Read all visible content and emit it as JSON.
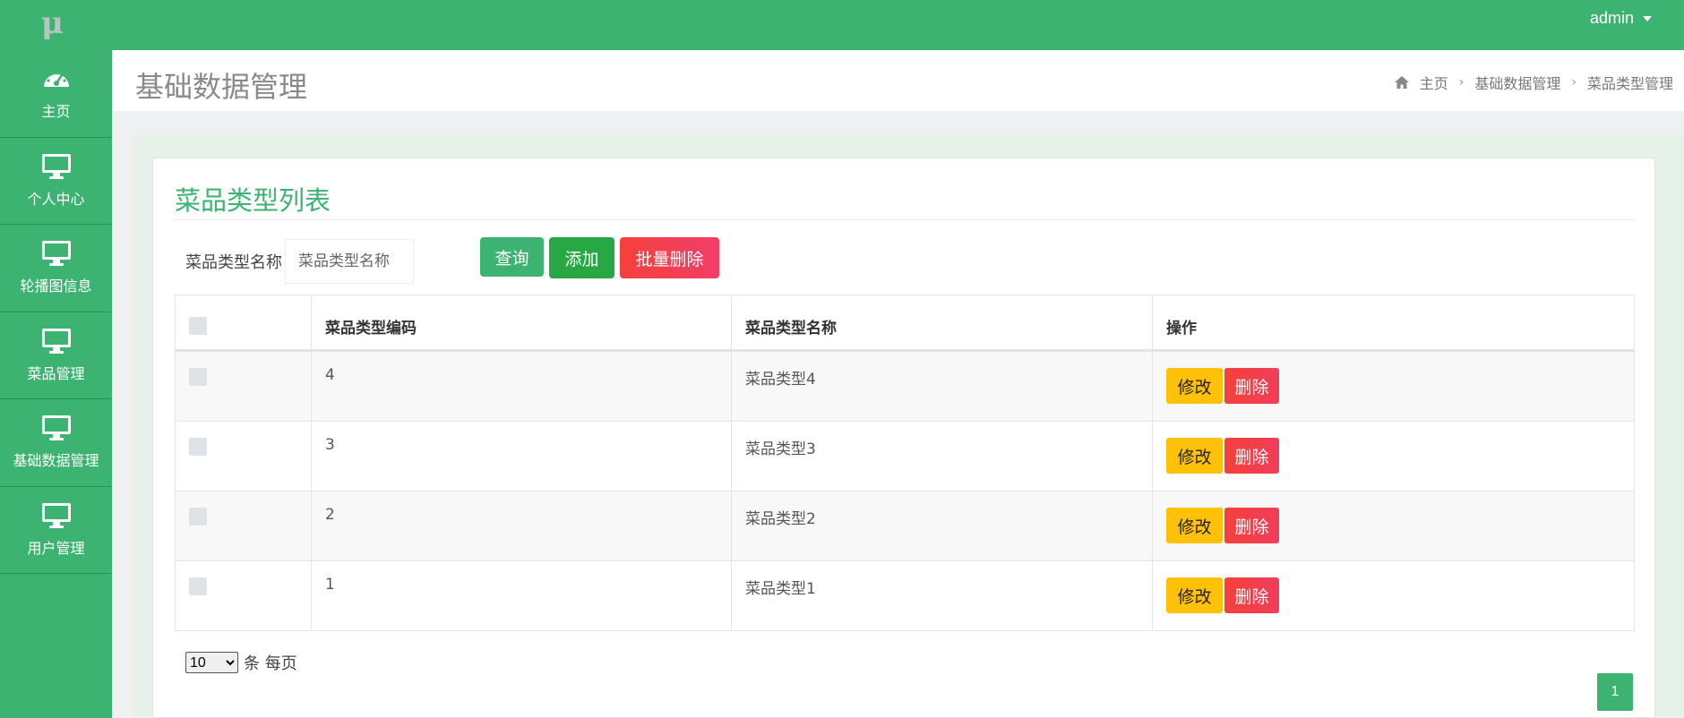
{
  "topbar": {
    "logo_text": "μ",
    "user_name": "admin"
  },
  "sidebar": {
    "items": [
      {
        "label": "主页",
        "icon": "dashboard-icon"
      },
      {
        "label": "个人中心",
        "icon": "monitor-icon"
      },
      {
        "label": "轮播图信息",
        "icon": "monitor-icon"
      },
      {
        "label": "菜品管理",
        "icon": "monitor-icon"
      },
      {
        "label": "基础数据管理",
        "icon": "monitor-icon"
      },
      {
        "label": "用户管理",
        "icon": "monitor-icon"
      }
    ]
  },
  "header": {
    "title": "基础数据管理",
    "breadcrumb": [
      "主页",
      "基础数据管理",
      "菜品类型管理"
    ]
  },
  "panel": {
    "title": "菜品类型列表",
    "search_label": "菜品类型名称",
    "search_placeholder": "菜品类型名称",
    "query_button": "查询",
    "add_button": "添加",
    "batch_delete_button": "批量删除"
  },
  "table": {
    "columns": [
      "",
      "菜品类型编码",
      "菜品类型名称",
      "操作"
    ],
    "rows": [
      {
        "code": "4",
        "name": "菜品类型4"
      },
      {
        "code": "3",
        "name": "菜品类型3"
      },
      {
        "code": "2",
        "name": "菜品类型2"
      },
      {
        "code": "1",
        "name": "菜品类型1"
      }
    ],
    "edit_label": "修改",
    "delete_label": "删除"
  },
  "pagination": {
    "page_size": "10",
    "page_size_suffix": "条 每页",
    "current_page": "1"
  },
  "colors": {
    "primary": "#3cb371",
    "warning": "#ffc107",
    "danger": "#f4413b"
  }
}
